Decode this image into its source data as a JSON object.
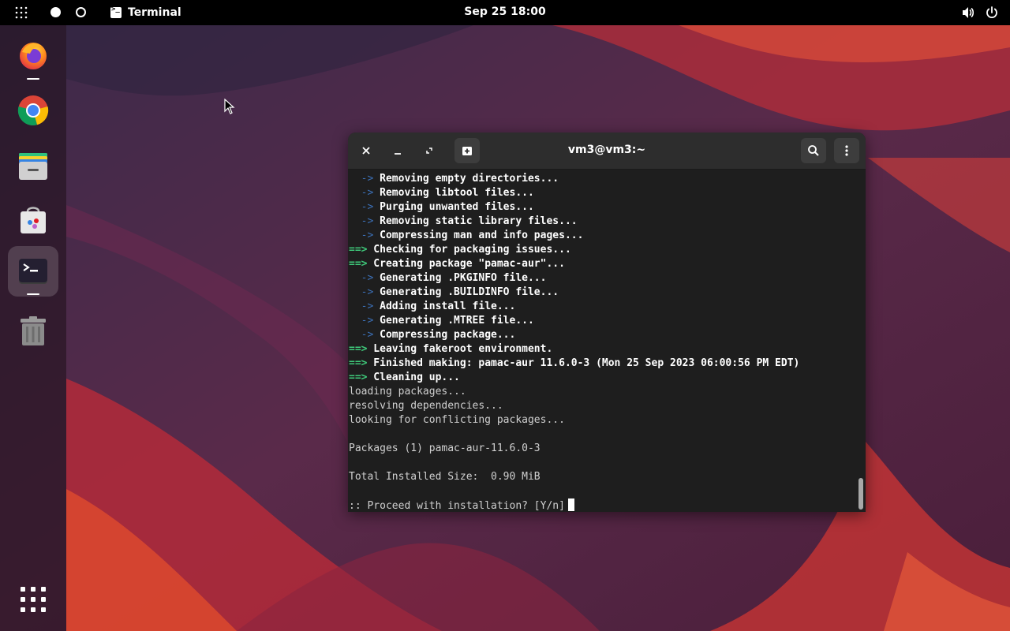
{
  "topbar": {
    "activities_icon": "grid-dots-icon",
    "app_name": "Terminal",
    "clock": "Sep 25  18:00",
    "volume_icon": "volume-icon",
    "power_icon": "power-icon"
  },
  "dock": {
    "items": [
      {
        "name": "Firefox",
        "icon": "firefox-icon",
        "running": true
      },
      {
        "name": "Google Chrome",
        "icon": "chrome-icon",
        "running": false
      },
      {
        "name": "Files",
        "icon": "files-icon",
        "running": false
      },
      {
        "name": "Software",
        "icon": "software-store-icon",
        "running": false
      },
      {
        "name": "Terminal",
        "icon": "terminal-icon",
        "running": true,
        "active": true
      },
      {
        "name": "Trash",
        "icon": "trash-icon",
        "running": false
      }
    ],
    "show_apps_icon": "apps-grid-icon"
  },
  "terminal": {
    "title": "vm3@vm3:~",
    "lines": [
      {
        "prefix": "  ->",
        "prefix_type": "arrow",
        "text": " Removing empty directories...",
        "style": "bold"
      },
      {
        "prefix": "  ->",
        "prefix_type": "arrow",
        "text": " Removing libtool files...",
        "style": "bold"
      },
      {
        "prefix": "  ->",
        "prefix_type": "arrow",
        "text": " Purging unwanted files...",
        "style": "bold"
      },
      {
        "prefix": "  ->",
        "prefix_type": "arrow",
        "text": " Removing static library files...",
        "style": "bold"
      },
      {
        "prefix": "  ->",
        "prefix_type": "arrow",
        "text": " Compressing man and info pages...",
        "style": "bold"
      },
      {
        "prefix": "==>",
        "prefix_type": "eq",
        "text": " Checking for packaging issues...",
        "style": "bold"
      },
      {
        "prefix": "==>",
        "prefix_type": "eq",
        "text": " Creating package \"pamac-aur\"...",
        "style": "bold"
      },
      {
        "prefix": "  ->",
        "prefix_type": "arrow",
        "text": " Generating .PKGINFO file...",
        "style": "bold"
      },
      {
        "prefix": "  ->",
        "prefix_type": "arrow",
        "text": " Generating .BUILDINFO file...",
        "style": "bold"
      },
      {
        "prefix": "  ->",
        "prefix_type": "arrow",
        "text": " Adding install file...",
        "style": "bold"
      },
      {
        "prefix": "  ->",
        "prefix_type": "arrow",
        "text": " Generating .MTREE file...",
        "style": "bold"
      },
      {
        "prefix": "  ->",
        "prefix_type": "arrow",
        "text": " Compressing package...",
        "style": "bold"
      },
      {
        "prefix": "==>",
        "prefix_type": "eq",
        "text": " Leaving fakeroot environment.",
        "style": "bold"
      },
      {
        "prefix": "==>",
        "prefix_type": "eq",
        "text": " Finished making: pamac-aur 11.6.0-3 (Mon 25 Sep 2023 06:00:56 PM EDT)",
        "style": "bold"
      },
      {
        "prefix": "==>",
        "prefix_type": "eq",
        "text": " Cleaning up...",
        "style": "bold"
      },
      {
        "prefix": "",
        "prefix_type": "none",
        "text": "loading packages...",
        "style": "plain"
      },
      {
        "prefix": "",
        "prefix_type": "none",
        "text": "resolving dependencies...",
        "style": "plain"
      },
      {
        "prefix": "",
        "prefix_type": "none",
        "text": "looking for conflicting packages...",
        "style": "plain"
      },
      {
        "prefix": "",
        "prefix_type": "none",
        "text": "",
        "style": "plain"
      },
      {
        "prefix": "",
        "prefix_type": "none",
        "text": "Packages (1) pamac-aur-11.6.0-3",
        "style": "plain"
      },
      {
        "prefix": "",
        "prefix_type": "none",
        "text": "",
        "style": "plain"
      },
      {
        "prefix": "",
        "prefix_type": "none",
        "text": "Total Installed Size:  0.90 MiB",
        "style": "plain"
      },
      {
        "prefix": "",
        "prefix_type": "none",
        "text": "",
        "style": "plain"
      }
    ],
    "prompt": ":: Proceed with installation? [Y/n]"
  }
}
